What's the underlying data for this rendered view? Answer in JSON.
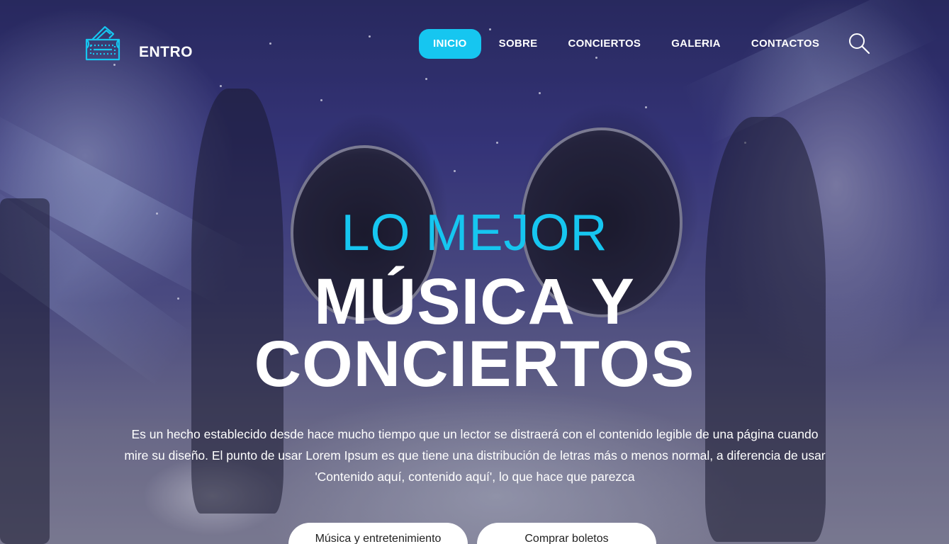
{
  "brand": {
    "name": "ENTRO",
    "logo_icon": "ticket-icon",
    "accent": "#16c6f0"
  },
  "nav": {
    "items": [
      {
        "label": "INICIO",
        "active": true
      },
      {
        "label": "SOBRE",
        "active": false
      },
      {
        "label": "CONCIERTOS",
        "active": false
      },
      {
        "label": "GALERIA",
        "active": false
      },
      {
        "label": "CONTACTOS",
        "active": false
      }
    ],
    "search_icon": "search-icon"
  },
  "hero": {
    "kicker": "LO MEJOR",
    "headline_line1": "MÚSICA Y",
    "headline_line2": "CONCIERTOS",
    "description_line1": "Es un hecho establecido desde hace mucho tiempo que un lector se distraerá con el contenido legible de una página cuando",
    "description_line2": "mire su diseño. El punto de usar Lorem Ipsum es que tiene una distribución de letras más o menos normal, a diferencia de usar",
    "description_line3": "'Contenido aquí, contenido aquí', lo que hace que parezca"
  },
  "buttons": {
    "primary": "Música y entretenimiento",
    "secondary": "Comprar boletos"
  },
  "colors": {
    "accent": "#16c6f0",
    "text": "#ffffff",
    "button_bg": "#ffffff"
  }
}
